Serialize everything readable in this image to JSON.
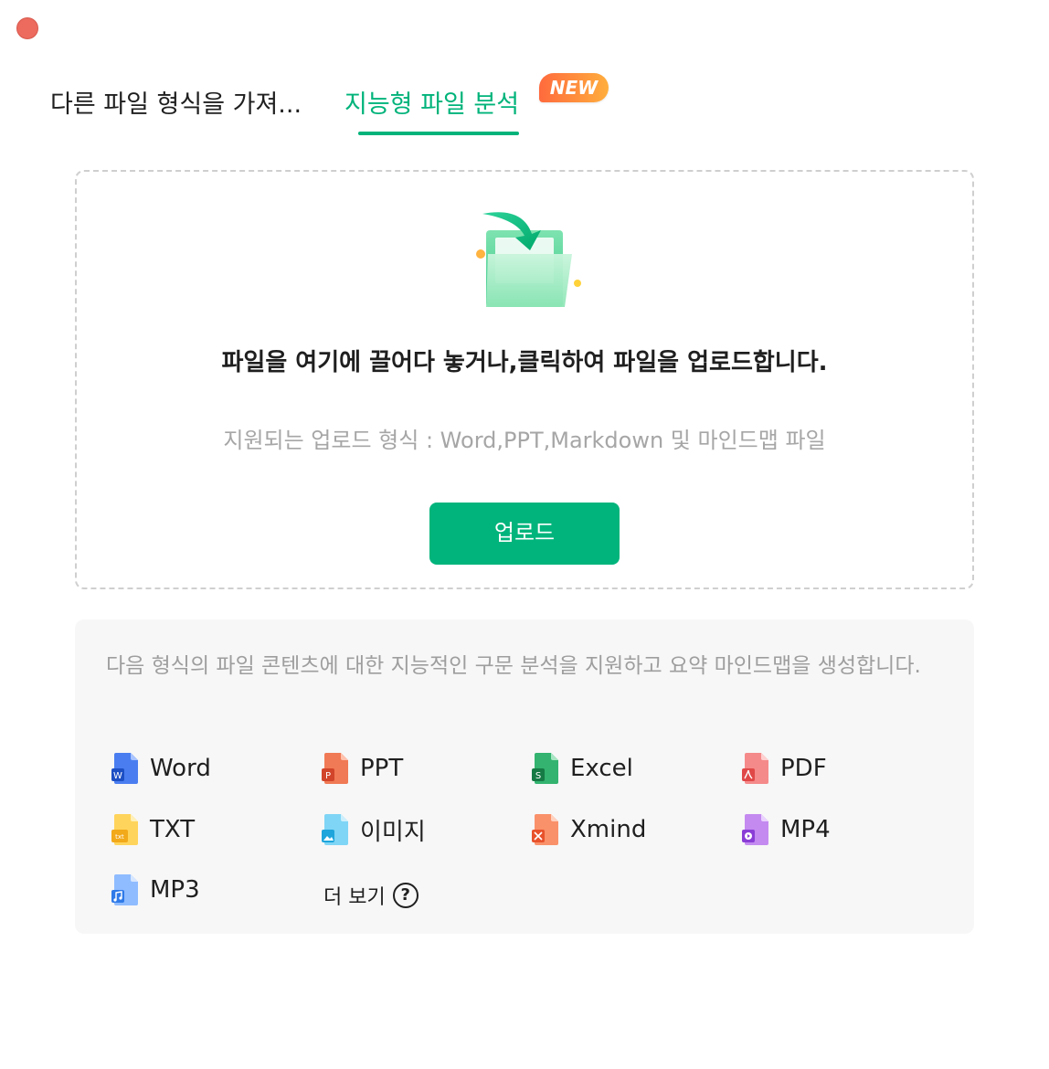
{
  "window": {
    "close_color": "#ec6a5e"
  },
  "tabs": [
    {
      "label": "다른 파일 형식을 가져..."
    },
    {
      "label": "지능형 파일 분석",
      "badge": "NEW"
    }
  ],
  "dropzone": {
    "title": "파일을 여기에 끌어다 놓거나,클릭하여 파일을 업로드합니다.",
    "subtitle": "지원되는 업로드 형식 : Word,PPT,Markdown 및 마인드맵 파일",
    "upload_label": "업로드",
    "icon": "folder-upload-icon"
  },
  "formats": {
    "description": "다음 형식의 파일 콘텐츠에 대한 지능적인 구문 분석을 지원하고 요약 마인드맵을 생성합니다.",
    "items": [
      {
        "label": "Word",
        "icon": "word-file-icon",
        "color": "#2b5fd9"
      },
      {
        "label": "PPT",
        "icon": "ppt-file-icon",
        "color": "#e2553a"
      },
      {
        "label": "Excel",
        "icon": "excel-file-icon",
        "color": "#1c8f5a"
      },
      {
        "label": "PDF",
        "icon": "pdf-file-icon",
        "color": "#e8454a"
      },
      {
        "label": "TXT",
        "icon": "txt-file-icon",
        "color": "#f5b820"
      },
      {
        "label": "이미지",
        "icon": "image-file-icon",
        "color": "#2fb3e8"
      },
      {
        "label": "Xmind",
        "icon": "xmind-file-icon",
        "color": "#f0643a"
      },
      {
        "label": "MP4",
        "icon": "mp4-file-icon",
        "color": "#9b4de0"
      },
      {
        "label": "MP3",
        "icon": "mp3-file-icon",
        "color": "#3b8ef0"
      }
    ],
    "more_label": "더 보기",
    "help_symbol": "?"
  },
  "colors": {
    "accent": "#00b37a",
    "badge_start": "#ff6a3d",
    "badge_end": "#ffae3d"
  }
}
